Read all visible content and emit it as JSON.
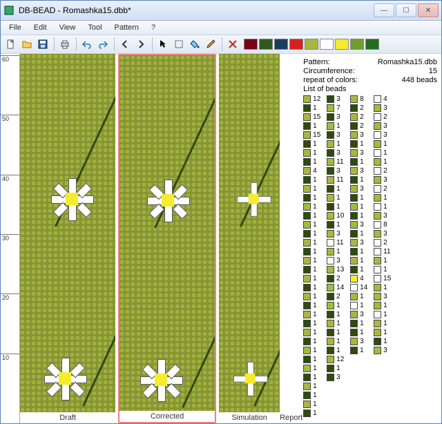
{
  "window": {
    "title": "DB-BEAD - Romashka15.dbb*"
  },
  "menu": {
    "items": [
      "File",
      "Edit",
      "View",
      "Tool",
      "Pattern",
      "?"
    ]
  },
  "toolbar": {
    "swatches": [
      "#7a0018",
      "#2e5a1e",
      "#1a3d5e",
      "#d82020",
      "#a7b83e",
      "#ffffff",
      "#f6ec2c",
      "#759c2e",
      "#216e21"
    ]
  },
  "ruler": {
    "ticks": [
      60,
      50,
      40,
      30,
      20,
      10
    ]
  },
  "views": {
    "draft": "Draft",
    "corrected": "Corrected",
    "simulation": "Simulation",
    "report": "Report"
  },
  "info": {
    "pattern_label": "Pattern:",
    "pattern_value": "Romashka15.dbb",
    "circ_label": "Circumference:",
    "circ_value": "15",
    "repeat_label": "repeat of colors:",
    "repeat_value": "448 beads",
    "list_label": "List of beads"
  },
  "bead_colors": {
    "olive": "#a7b83e",
    "dark": "#2f4b0f",
    "white": "#ffffff",
    "yellow": "#f6ec2c"
  },
  "bead_list": {
    "col1": [
      [
        "olive",
        12
      ],
      [
        "dark",
        1
      ],
      [
        "olive",
        15
      ],
      [
        "dark",
        1
      ],
      [
        "olive",
        15
      ],
      [
        "dark",
        1
      ],
      [
        "olive",
        1
      ],
      [
        "dark",
        1
      ],
      [
        "olive",
        4
      ],
      [
        "dark",
        1
      ],
      [
        "olive",
        1
      ],
      [
        "dark",
        1
      ],
      [
        "olive",
        1
      ],
      [
        "dark",
        1
      ],
      [
        "olive",
        1
      ],
      [
        "dark",
        1
      ],
      [
        "olive",
        1
      ],
      [
        "dark",
        1
      ],
      [
        "olive",
        1
      ],
      [
        "dark",
        1
      ],
      [
        "olive",
        1
      ],
      [
        "dark",
        1
      ],
      [
        "olive",
        1
      ],
      [
        "dark",
        1
      ],
      [
        "olive",
        1
      ],
      [
        "dark",
        1
      ],
      [
        "olive",
        1
      ],
      [
        "dark",
        1
      ],
      [
        "olive",
        1
      ],
      [
        "dark",
        1
      ],
      [
        "olive",
        1
      ],
      [
        "dark",
        1
      ],
      [
        "olive",
        1
      ],
      [
        "dark",
        1
      ],
      [
        "olive",
        1
      ],
      [
        "dark",
        1
      ]
    ],
    "col2": [
      [
        "dark",
        3
      ],
      [
        "olive",
        7
      ],
      [
        "dark",
        3
      ],
      [
        "olive",
        1
      ],
      [
        "dark",
        3
      ],
      [
        "olive",
        1
      ],
      [
        "dark",
        3
      ],
      [
        "olive",
        11
      ],
      [
        "dark",
        3
      ],
      [
        "olive",
        11
      ],
      [
        "dark",
        1
      ],
      [
        "olive",
        1
      ],
      [
        "dark",
        1
      ],
      [
        "olive",
        10
      ],
      [
        "dark",
        1
      ],
      [
        "olive",
        3
      ],
      [
        "white",
        11
      ],
      [
        "olive",
        1
      ],
      [
        "white",
        3
      ],
      [
        "olive",
        13
      ],
      [
        "dark",
        2
      ],
      [
        "olive",
        14
      ],
      [
        "dark",
        2
      ],
      [
        "olive",
        1
      ],
      [
        "dark",
        1
      ],
      [
        "olive",
        1
      ],
      [
        "dark",
        1
      ],
      [
        "olive",
        1
      ],
      [
        "dark",
        1
      ],
      [
        "olive",
        12
      ],
      [
        "dark",
        1
      ],
      [
        "dark",
        3
      ]
    ],
    "col3": [
      [
        "olive",
        8
      ],
      [
        "dark",
        2
      ],
      [
        "olive",
        2
      ],
      [
        "dark",
        2
      ],
      [
        "olive",
        3
      ],
      [
        "dark",
        1
      ],
      [
        "olive",
        3
      ],
      [
        "dark",
        1
      ],
      [
        "olive",
        3
      ],
      [
        "dark",
        1
      ],
      [
        "olive",
        3
      ],
      [
        "dark",
        1
      ],
      [
        "olive",
        1
      ],
      [
        "dark",
        1
      ],
      [
        "olive",
        3
      ],
      [
        "dark",
        1
      ],
      [
        "olive",
        3
      ],
      [
        "dark",
        1
      ],
      [
        "olive",
        1
      ],
      [
        "dark",
        1
      ],
      [
        "yellow",
        4
      ],
      [
        "white",
        14
      ],
      [
        "olive",
        1
      ],
      [
        "white",
        1
      ],
      [
        "olive",
        3
      ],
      [
        "dark",
        1
      ],
      [
        "dark",
        1
      ],
      [
        "olive",
        3
      ],
      [
        "dark",
        1
      ]
    ],
    "col4": [
      [
        "white",
        4
      ],
      [
        "olive",
        3
      ],
      [
        "white",
        2
      ],
      [
        "olive",
        3
      ],
      [
        "white",
        3
      ],
      [
        "olive",
        1
      ],
      [
        "white",
        1
      ],
      [
        "olive",
        1
      ],
      [
        "white",
        2
      ],
      [
        "olive",
        3
      ],
      [
        "white",
        2
      ],
      [
        "olive",
        1
      ],
      [
        "white",
        1
      ],
      [
        "olive",
        3
      ],
      [
        "white",
        8
      ],
      [
        "olive",
        3
      ],
      [
        "white",
        2
      ],
      [
        "white",
        11
      ],
      [
        "olive",
        1
      ],
      [
        "white",
        1
      ],
      [
        "white",
        15
      ],
      [
        "olive",
        1
      ],
      [
        "olive",
        3
      ],
      [
        "olive",
        1
      ],
      [
        "white",
        1
      ],
      [
        "olive",
        1
      ],
      [
        "olive",
        1
      ],
      [
        "dark",
        1
      ],
      [
        "olive",
        3
      ]
    ]
  }
}
